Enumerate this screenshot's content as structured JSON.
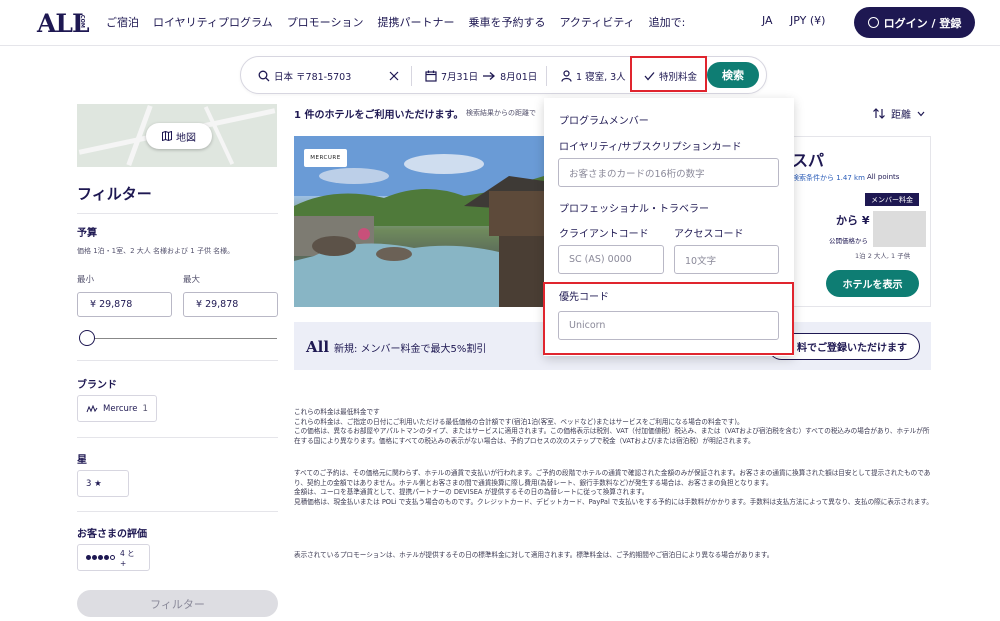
{
  "header": {
    "logo": "ALL",
    "logo_suffix": ".COM",
    "nav": [
      "ご宿泊",
      "ロイヤリティプログラム",
      "プロモーション",
      "提携パートナー",
      "乗車を予約する",
      "アクティビティ",
      "追加で:"
    ],
    "lang": "JA",
    "currency": "JPY (¥)",
    "login": "ログイン / 登録"
  },
  "search": {
    "destination": "日本 〒781-5703",
    "checkin": "7月31日",
    "checkout": "8月01日",
    "guests": "1 寝室, 3人",
    "special_rate": "特別料金",
    "search_button": "検索"
  },
  "sidebar": {
    "map_button": "地図",
    "filter_title": "フィルター",
    "budget_title": "予算",
    "budget_note": "価格 1泊・1室、2 大人 名様および 1 子供 名様。",
    "min_label": "最小",
    "max_label": "最大",
    "min_value": "¥ 29,878",
    "max_value": "¥ 29,878",
    "brand_title": "ブランド",
    "brand_chip": "Mercure",
    "brand_count": "1",
    "stars_title": "星",
    "stars_chip": "3 ★",
    "rating_title": "お客さまの評価",
    "rating_chip": "4 と +",
    "filter_button": "フィルター"
  },
  "results": {
    "count_text": "1 件のホテルをご利用いただけます。",
    "sub_text": "検索結果からの距離で",
    "sort_label": "距離",
    "hotel": {
      "brand_badge": "MERCURE",
      "name_fragment": "スパ",
      "distance_fragment": "検索条件から 1.47 km",
      "all_points": "All points",
      "member_badge": "メンバー料金",
      "from_label": "から ¥",
      "public_price": "公開価格から",
      "nights_note": "1泊 2 大人, 1 子供",
      "view_button": "ホテルを表示"
    },
    "promo": {
      "logo": "All",
      "text": "新規: メンバー料金で最大5%割引",
      "button": "料でご登録いただけます"
    }
  },
  "dropdown": {
    "program_member": "プログラムメンバー",
    "loyalty_card_label": "ロイヤリティ/サブスクリプションカード",
    "loyalty_card_placeholder": "お客さまのカードの16桁の数字",
    "professional": "プロフェッショナル・トラベラー",
    "client_code_label": "クライアントコード",
    "access_code_label": "アクセスコード",
    "client_code_placeholder": "SC (AS) 0000",
    "access_code_placeholder": "10文字",
    "priority_code_label": "優先コード",
    "priority_code_placeholder": "Unicorn"
  },
  "disclaimer": {
    "p1": "これらの料金は最低料金です\nこれらの料金は、ご指定の日付にご利用いただける最低価格の合計額です(宿泊1泊(客室、ベッドなど)またはサービスをご利用になる場合の料金です)。\nこの価格は、異なるお部屋やアパルトマンのタイプ、またはサービスに適用されます。この価格表示は税別、VAT（付加価値税）税込み、または（VATおよび宿泊税を含む）すべての税込みの場合があり、ホテルが所在する国により異なります。価格にすべての税込みの表示がない場合は、予約プロセスの次のステップで税金（VATおよび/または宿泊税）が明記されます。",
    "p2": "すべてのご予約は、その価格元に関わらず、ホテルの通貨で支払いが行われます。ご予約の段階でホテルの通貨で確認された金額のみが保証されます。お客さまの通貨に換算された額は目安として提示されたものであり、契約上の金額ではありません。ホテル側とお客さまの間で通貨換算に際し費用(為替レート、銀行手数料など)が発生する場合は、お客さまの負担となります。\n金額は、ユーロを基準通貨として、提携パートナーの DEVISEA が提供するその日の為替レートに従って換算されます。\n見積価格は、現金払いまたは POLi で支払う場合のものです。クレジットカード、デビットカード、PayPal で支払いをする予約には手数料がかかります。手数料は支払方法によって異なり、支払の際に表示されます。",
    "p3": "表示されているプロモーションは、ホテルが提供するその日の標準料金に対して適用されます。標準料金は、ご予約期間やご宿泊日により異なる場合があります。"
  },
  "colors": {
    "brand": "#1e1852",
    "accent_green": "#0e7d73",
    "highlight_red": "#e0252e"
  }
}
